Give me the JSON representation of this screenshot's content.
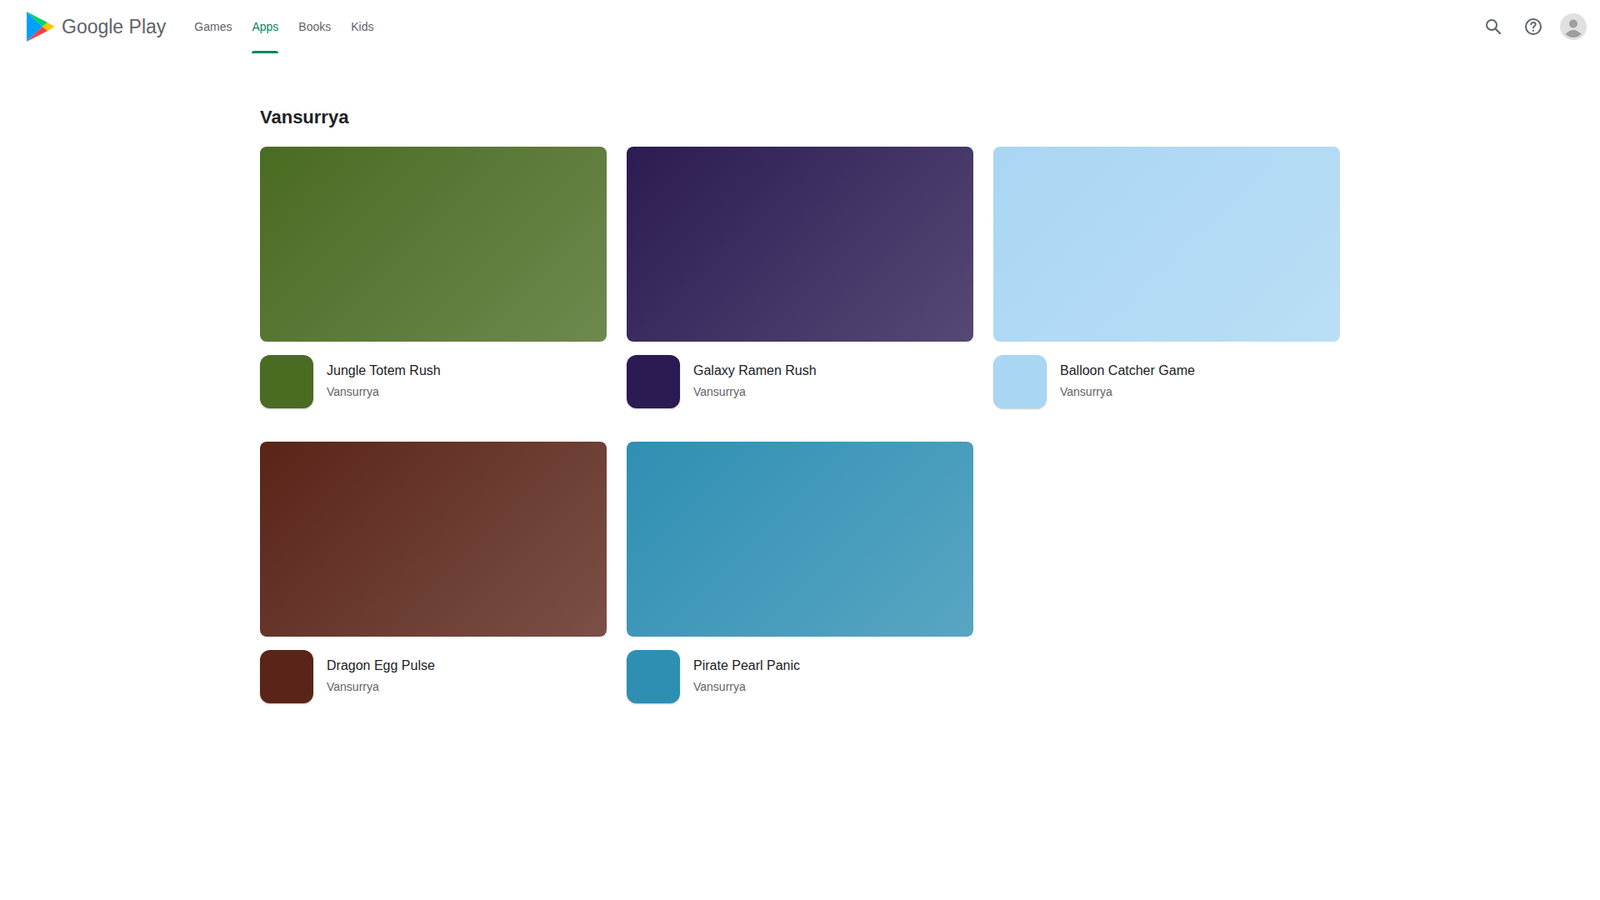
{
  "header": {
    "logo": "Google Play",
    "nav": [
      {
        "label": "Games",
        "selected": false
      },
      {
        "label": "Apps",
        "selected": true
      },
      {
        "label": "Books",
        "selected": false
      },
      {
        "label": "Kids",
        "selected": false
      }
    ]
  },
  "developer": "Vansurrya",
  "apps": [
    {
      "title": "Jungle Totem Rush",
      "developer": "Vansurrya",
      "color": "#4a6b22"
    },
    {
      "title": "Galaxy Ramen Rush",
      "developer": "Vansurrya",
      "color": "#2b1b52"
    },
    {
      "title": "Balloon Catcher Game",
      "developer": "Vansurrya",
      "color": "#a9d6f3"
    },
    {
      "title": "Dragon Egg Pulse",
      "developer": "Vansurrya",
      "color": "#5a2418"
    },
    {
      "title": "Pirate Pearl Panic",
      "developer": "Vansurrya",
      "color": "#2f8fb3"
    }
  ]
}
